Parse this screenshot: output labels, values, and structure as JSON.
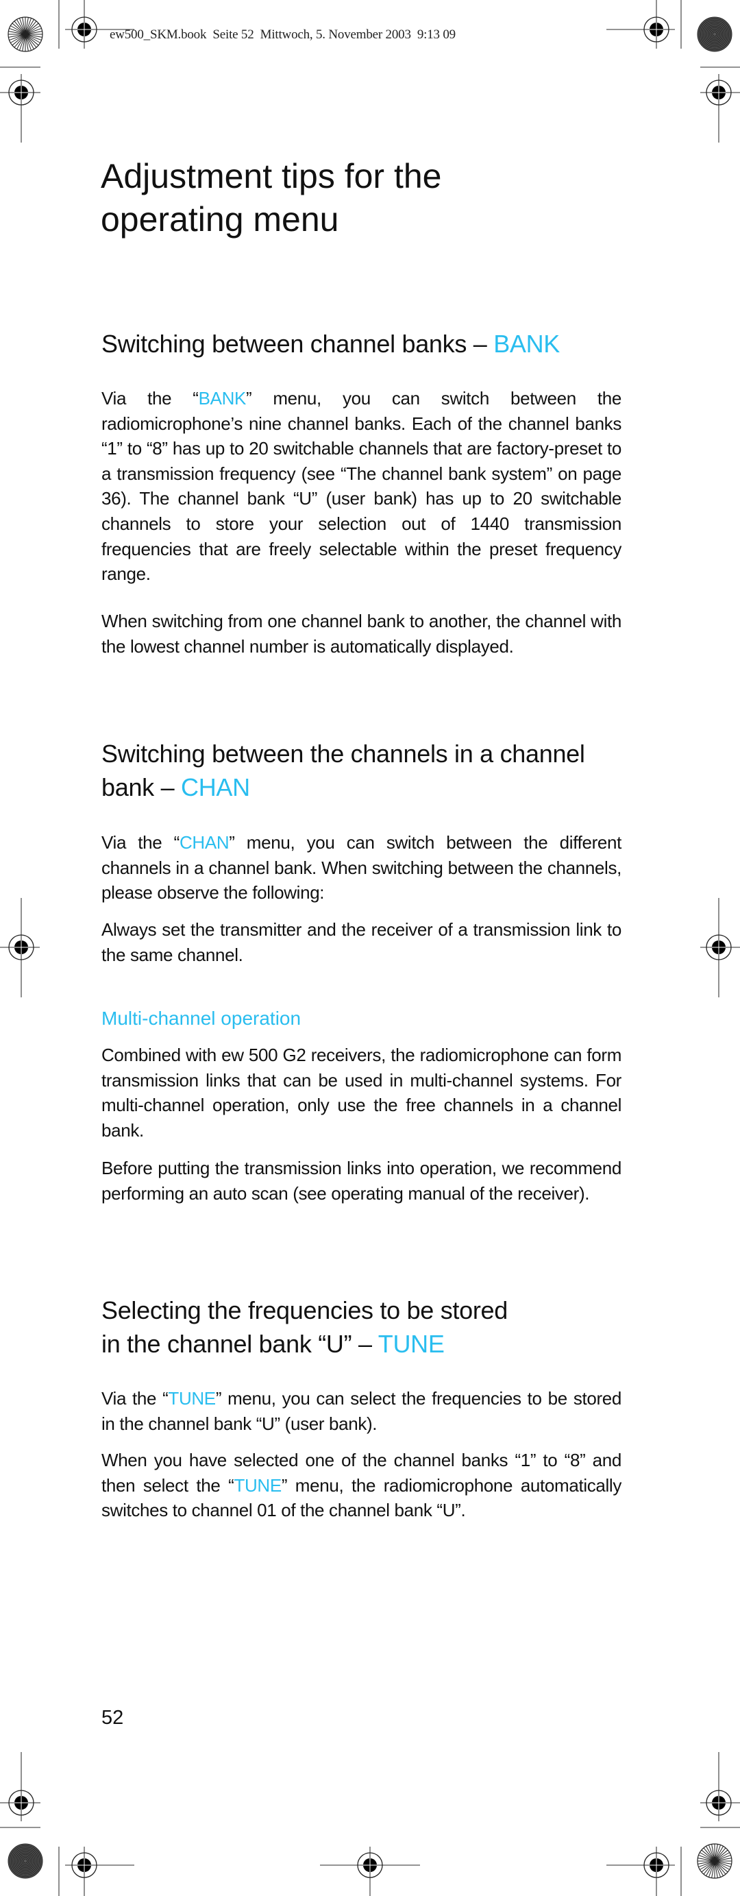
{
  "header": {
    "print_slug": "ew500_SKM.book  Seite 52  Mittwoch, 5. November 2003  9:13 09"
  },
  "page": {
    "title_line1": "Adjustment tips for the",
    "title_line2": "operating menu",
    "page_number": "52"
  },
  "colors": {
    "accent": "#29BDEF",
    "text": "#111111"
  },
  "sections": [
    {
      "heading_text": "Switching between channel banks – ",
      "heading_keyword": "BANK",
      "paragraphs": [
        {
          "pre": "Via the “",
          "keyword": "BANK",
          "post": "” menu, you can switch between the radiomicrophone’s nine channel banks. Each of the channel banks “1” to “8” has up to 20 switchable channels that are factory-preset to a transmission frequency (see “The channel bank system” on page 36). The channel bank “U” (user bank) has up to 20 switchable channels to store your selection out of 1440 transmission frequencies that are freely selectable within the preset frequency range."
        },
        {
          "text": "When switching from one channel bank to another, the channel with the lowest channel number is automatically displayed."
        }
      ]
    },
    {
      "heading_line1": "Switching between the channels in a channel",
      "heading_line2_text": "bank – ",
      "heading_keyword": "CHAN",
      "paragraphs": [
        {
          "pre": "Via the “",
          "keyword": "CHAN",
          "post": "” menu, you can switch between the different channels in a channel bank. When switching between the channels, please observe the following:"
        },
        {
          "text": "Always set the transmitter and the receiver of a transmission link to the same channel."
        }
      ],
      "subsection": {
        "heading": "Multi-channel operation",
        "paragraphs": [
          {
            "text": "Combined with ew 500 G2 receivers, the radiomicrophone can form transmission links that can be used in multi-channel systems. For multi-channel operation, only use the free channels in a channel bank."
          },
          {
            "text": "Before putting the transmission links into operation, we recommend performing an auto scan (see operating manual of the receiver)."
          }
        ]
      }
    },
    {
      "heading_line1": "Selecting the frequencies to be stored",
      "heading_line2_text": "in the channel bank “U” – ",
      "heading_keyword": "TUNE",
      "paragraphs": [
        {
          "pre": "Via the “",
          "keyword": "TUNE",
          "post": "” menu, you can select the frequencies to be stored in the channel bank “U” (user bank)."
        },
        {
          "pre": "When you have selected one of the channel banks “1” to “8” and then select the “",
          "keyword": "TUNE",
          "post": "” menu, the radiomicrophone automatically switches to channel 01 of the channel bank “U”."
        }
      ]
    }
  ],
  "print_marks": {
    "registration_mark_icon": "crosshair-target",
    "color_wheel_icon": "starburst-wheel",
    "gray_patch_icon": "concentric-disk"
  }
}
